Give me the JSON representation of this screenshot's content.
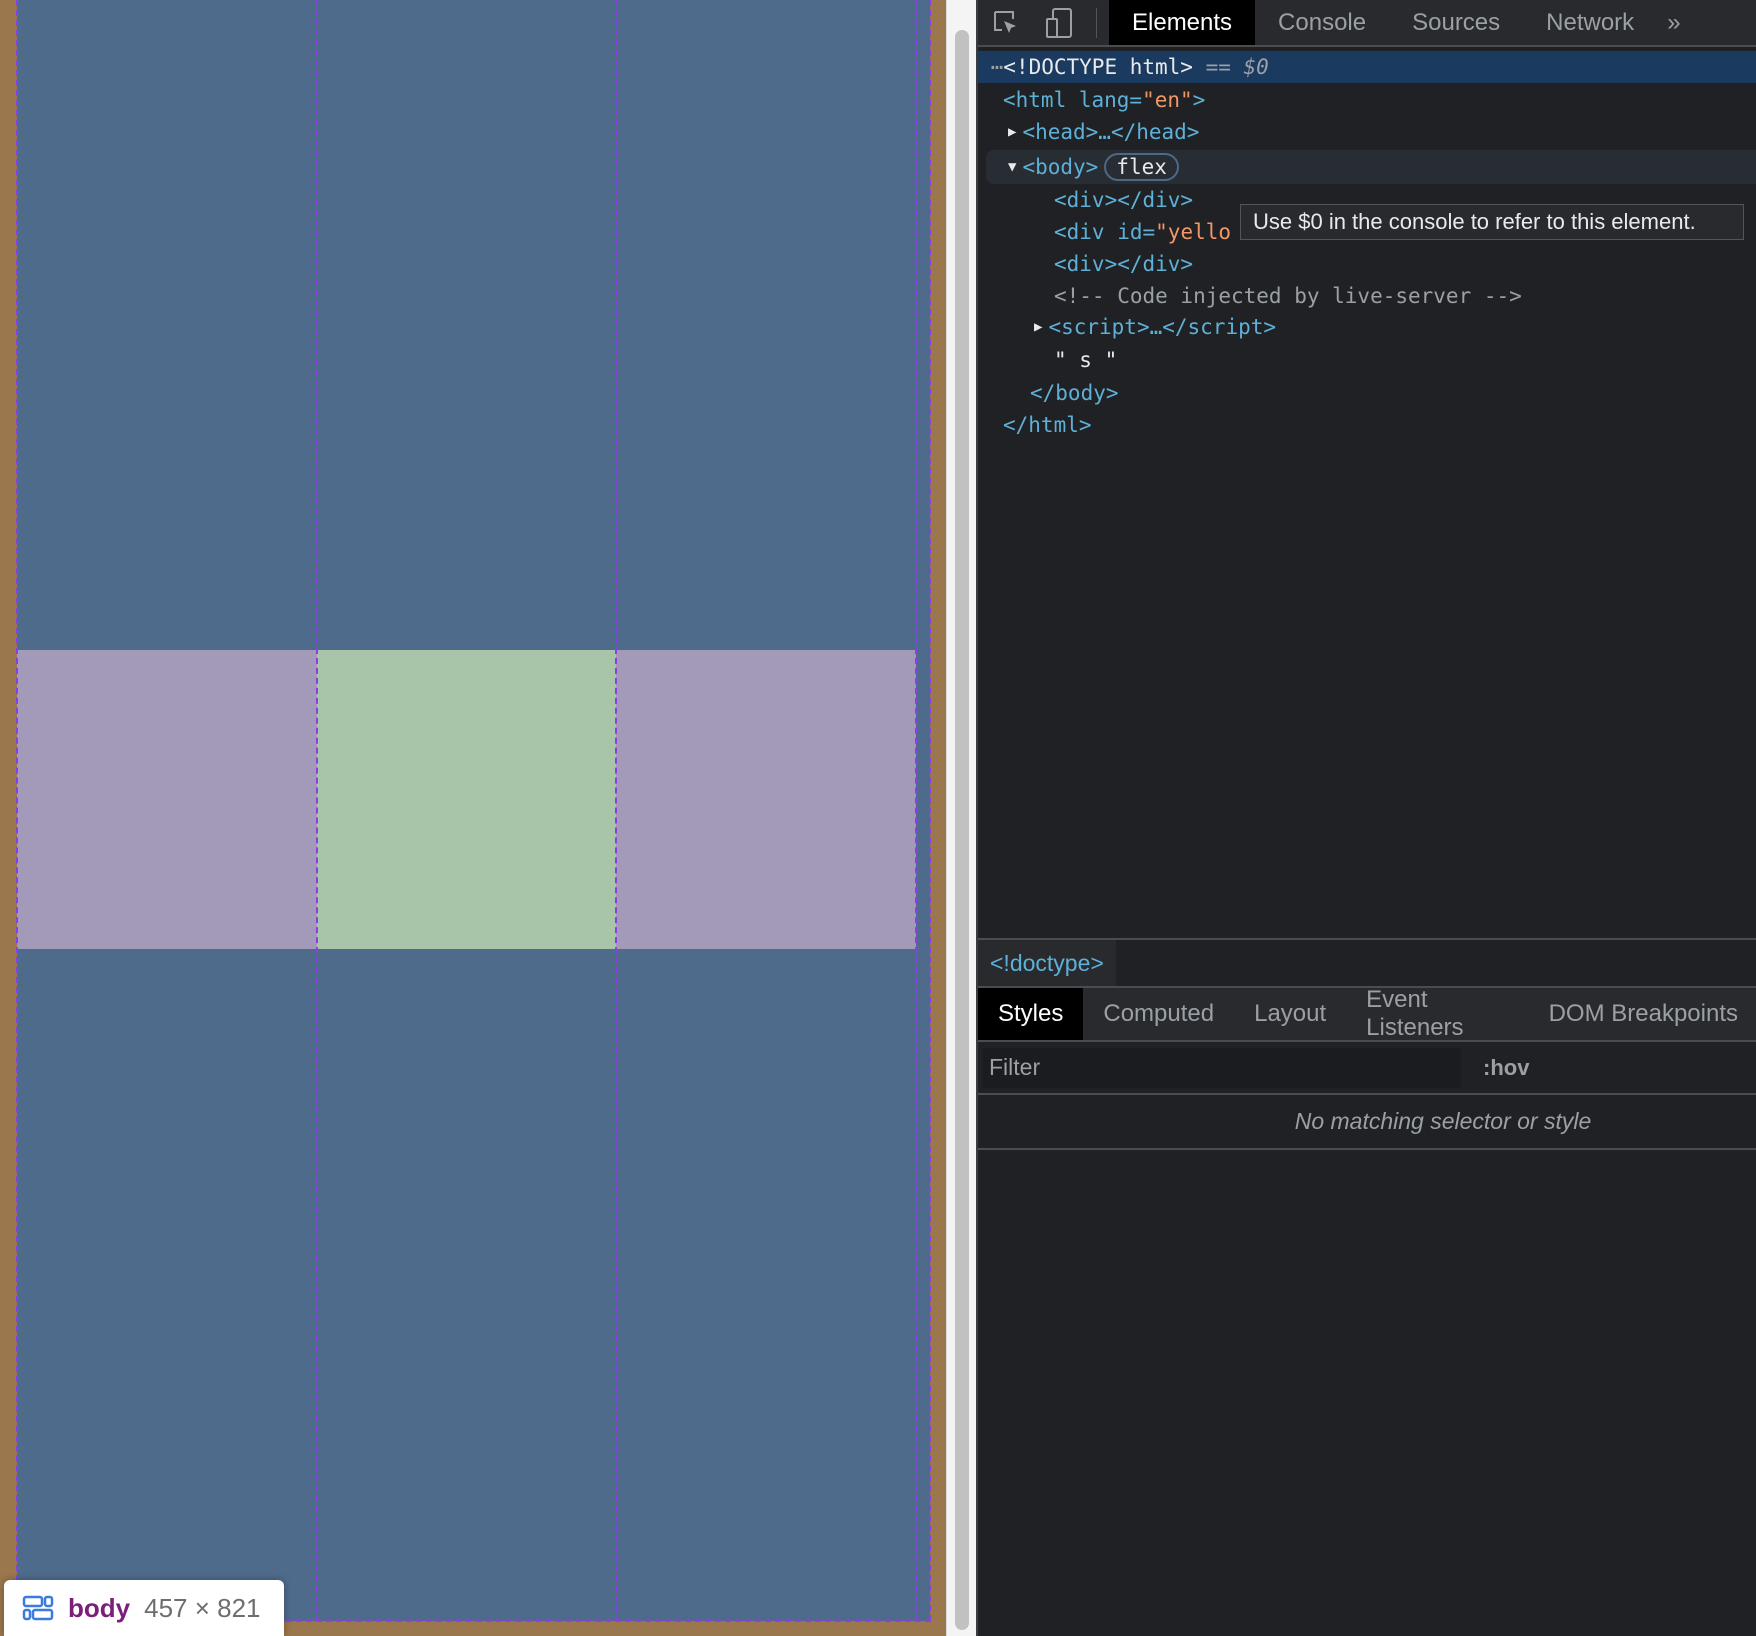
{
  "page": {
    "overlay": {
      "tag": "body",
      "size": "457 × 821"
    }
  },
  "colors": {
    "margin": "#9b774d",
    "cell": "#4f6b8b",
    "side": "#a29ab8",
    "center": "#a8c5a9"
  },
  "devtools": {
    "tabs": [
      "Elements",
      "Console",
      "Sources",
      "Network"
    ],
    "more": "»",
    "tree": {
      "doctype": "<!DOCTYPE html>",
      "eq": " == ",
      "ref": "$0",
      "html_open": "<html lang=",
      "lang": "\"en\"",
      "gt": ">",
      "head": "<head>…</head>",
      "body_open": "<body>",
      "flex_badge": "flex",
      "div1": "<div></div>",
      "div2_a": "<div id=",
      "div2_b": "\"yello",
      "div3": "<div></div>",
      "comment": "<!-- Code injected by live-server -->",
      "script": "<script>…</script>",
      "text": "\" s \"",
      "body_close": "</body>",
      "html_close": "</html>"
    },
    "tooltip": "Use $0 in the console to refer to this element.",
    "breadcrumb": "<!doctype>",
    "style_tabs": [
      "Styles",
      "Computed",
      "Layout",
      "Event Listeners",
      "DOM Breakpoints"
    ],
    "filter_placeholder": "Filter",
    "hov": ":hov",
    "empty": "No matching selector or style"
  }
}
